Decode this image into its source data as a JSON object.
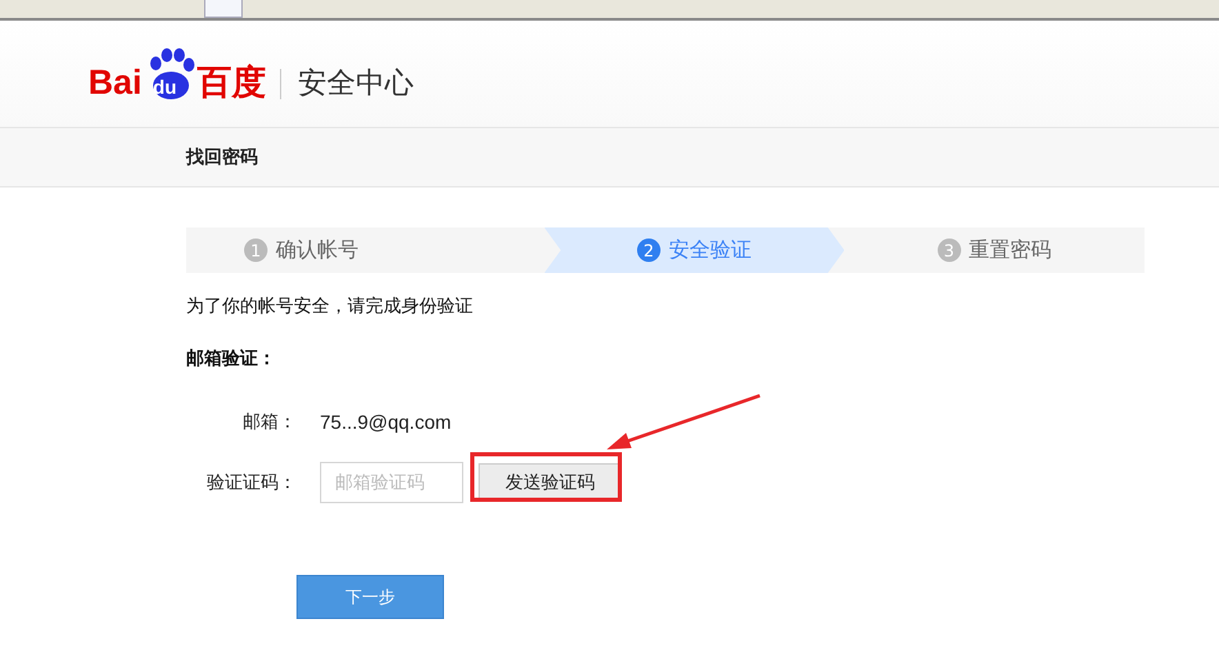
{
  "logo": {
    "text_left": "Bai",
    "text_badge": "du",
    "text_right": "百度"
  },
  "header": {
    "title": "安全中心"
  },
  "nav": {
    "title": "找回密码"
  },
  "steps": [
    {
      "number": "1",
      "label": "确认帐号",
      "selected": false
    },
    {
      "number": "2",
      "label": "安全验证",
      "selected": true
    },
    {
      "number": "3",
      "label": "重置密码",
      "selected": false
    }
  ],
  "intro": "为了你的帐号安全，请完成身份验证",
  "section_title": "邮箱验证：",
  "email": {
    "label": "邮箱：",
    "value": "75...9@qq.com"
  },
  "code": {
    "label": "验证证码：",
    "placeholder": "邮箱验证码",
    "button": "发送验证码"
  },
  "next_button": "下一步"
}
